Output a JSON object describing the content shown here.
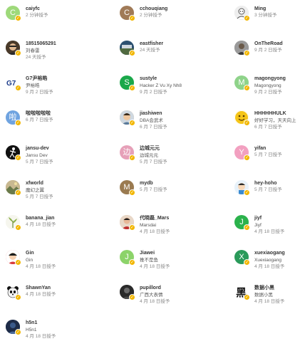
{
  "users": [
    {
      "name": "caiyfc",
      "lines": [
        "2 分钟授予"
      ],
      "avatar": {
        "type": "letter",
        "letter": "C",
        "color": "#9ed97a"
      }
    },
    {
      "name": "cchouqiang",
      "lines": [
        "2 分钟授予"
      ],
      "avatar": {
        "type": "letter",
        "letter": "C",
        "color": "#a07a57"
      }
    },
    {
      "name": "Ming",
      "lines": [
        "3 分钟授予"
      ],
      "avatar": {
        "type": "icon",
        "icon": "ming-avatar-icon",
        "color": "#d9d9d9"
      }
    },
    {
      "name": "18515065291",
      "lines": [
        "刘春雷",
        "24 天授予"
      ],
      "avatar": {
        "type": "icon",
        "icon": "photo-avatar-icon",
        "color": "#5a4430"
      }
    },
    {
      "name": "eastfisher",
      "lines": [
        "24 天授予"
      ],
      "avatar": {
        "type": "icon",
        "icon": "landscape-avatar-icon",
        "color": "#3a6a8a"
      }
    },
    {
      "name": "OnTheRoad",
      "lines": [
        "9 月 2 日授予"
      ],
      "avatar": {
        "type": "icon",
        "icon": "road-avatar-icon",
        "color": "#777777"
      }
    },
    {
      "name": "G7尹裕皓",
      "lines": [
        "尹裕皓",
        "9 月 2 日授予"
      ],
      "avatar": {
        "type": "icon",
        "icon": "g7-logo-icon",
        "color": "#ffffff"
      }
    },
    {
      "name": "sustyle",
      "lines": [
        "Hacker Z Vu Xy Nh8",
        "9 月 2 日授予"
      ],
      "avatar": {
        "type": "letter",
        "letter": "S",
        "color": "#1aa84a"
      }
    },
    {
      "name": "magongyong",
      "lines": [
        "Magongyong",
        "9 月 2 日授予"
      ],
      "avatar": {
        "type": "letter",
        "letter": "M",
        "color": "#8fd38a"
      }
    },
    {
      "name": "啦啦啦啦啦",
      "lines": [
        "6 月 7 日授予"
      ],
      "avatar": {
        "type": "letter",
        "letter": "啦",
        "color": "#6fa3e0"
      }
    },
    {
      "name": "jiashiwen",
      "lines": [
        "DBA会武术",
        "6 月 7 日授予"
      ],
      "avatar": {
        "type": "icon",
        "icon": "cartoon-avatar-icon",
        "color": "#c8a070"
      }
    },
    {
      "name": "HHHHHHULK",
      "lines": [
        "好好学习，天天向上",
        "6 月 7 日授予"
      ],
      "avatar": {
        "type": "icon",
        "icon": "emoji-face-icon",
        "color": "#f5c518"
      }
    },
    {
      "name": "jansu-dev",
      "lines": [
        "Jansu Dev",
        "5 月 7 日授予"
      ],
      "avatar": {
        "type": "icon",
        "icon": "figure-avatar-icon",
        "color": "#111111"
      }
    },
    {
      "name": "边城元元",
      "lines": [
        "边城元元",
        "5 月 7 日授予"
      ],
      "avatar": {
        "type": "letter",
        "letter": "边",
        "color": "#e6a0b8"
      }
    },
    {
      "name": "yifan",
      "lines": [
        "5 月 7 日授予"
      ],
      "avatar": {
        "type": "letter",
        "letter": "Y",
        "color": "#f2a0c0"
      }
    },
    {
      "name": "xfworld",
      "lines": [
        "魔幻之翼",
        "5 月 7 日授予"
      ],
      "avatar": {
        "type": "icon",
        "icon": "scenery-avatar-icon",
        "color": "#b8a070"
      }
    },
    {
      "name": "mydb",
      "lines": [
        "5 月 7 日授予"
      ],
      "avatar": {
        "type": "letter",
        "letter": "M",
        "color": "#9a7a50"
      }
    },
    {
      "name": "hey-hoho",
      "lines": [
        "5 月 7 日授予"
      ],
      "avatar": {
        "type": "icon",
        "icon": "cartoon-kid-icon",
        "color": "#dfeef8"
      }
    },
    {
      "name": "banana_jian",
      "lines": [
        "4 月 18 日授予"
      ],
      "avatar": {
        "type": "icon",
        "icon": "plant-avatar-icon",
        "color": "#f3f3e8"
      }
    },
    {
      "name": "代晓磊_Mars",
      "lines": [
        "Marsdai",
        "4 月 18 日授予"
      ],
      "avatar": {
        "type": "icon",
        "icon": "person-photo-icon",
        "color": "#d8a888"
      }
    },
    {
      "name": "jiyf",
      "lines": [
        "Jiyf",
        "4 月 18 日授予"
      ],
      "avatar": {
        "type": "letter",
        "letter": "J",
        "color": "#2bb24c"
      }
    },
    {
      "name": "Gin",
      "lines": [
        "Gin",
        "4 月 18 日授予"
      ],
      "avatar": {
        "type": "icon",
        "icon": "cartoon-red-icon",
        "color": "#e85a5a"
      }
    },
    {
      "name": "Jiawei",
      "lines": [
        "推不是鱼",
        "4 月 18 日授予"
      ],
      "avatar": {
        "type": "letter",
        "letter": "J",
        "color": "#8cd36a"
      }
    },
    {
      "name": "xuexiaogang",
      "lines": [
        "Xuexiaogang",
        "4 月 18 日授予"
      ],
      "avatar": {
        "type": "letter",
        "letter": "X",
        "color": "#2a9a5a"
      }
    },
    {
      "name": "ShawnYan",
      "lines": [
        "4 月 18 日授予"
      ],
      "avatar": {
        "type": "icon",
        "icon": "panda-avatar-icon",
        "color": "#ffffff"
      }
    },
    {
      "name": "pupillord",
      "lines": [
        "广西大表情",
        "4 月 18 日授予"
      ],
      "avatar": {
        "type": "icon",
        "icon": "dark-photo-icon",
        "color": "#333333"
      }
    },
    {
      "name": "数据小黑",
      "lines": [
        "数据小黑",
        "4 月 18 日授予"
      ],
      "avatar": {
        "type": "icon",
        "icon": "hei-character-icon",
        "color": "#ffffff"
      }
    },
    {
      "name": "h5n1",
      "lines": [
        "H5n1",
        "4 月 18 日授予"
      ],
      "avatar": {
        "type": "icon",
        "icon": "blue-photo-icon",
        "color": "#2a3a5a"
      }
    }
  ]
}
